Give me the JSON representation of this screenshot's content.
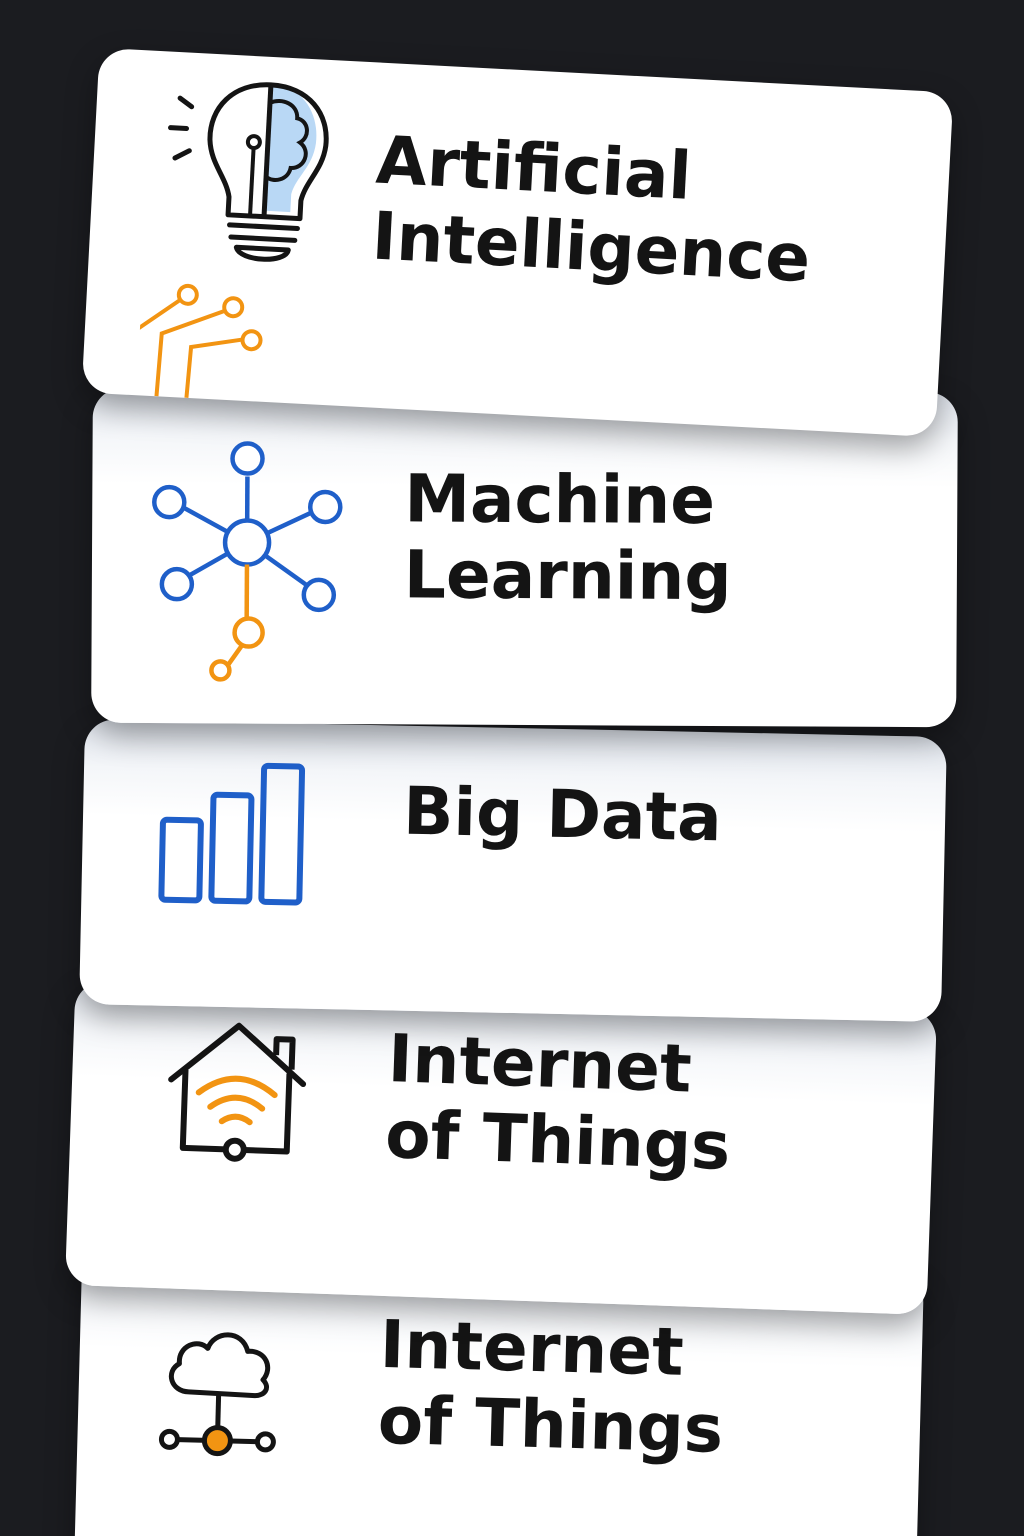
{
  "cards": [
    {
      "line1": "Artificial",
      "line2": "Intelligence",
      "icon": "ai-lightbulb-brain-icon"
    },
    {
      "line1": "Machine",
      "line2": "Learning",
      "icon": "network-nodes-icon"
    },
    {
      "line1": "Big Data",
      "line2": "",
      "icon": "bar-chart-icon"
    },
    {
      "line1": "Internet",
      "line2": "of Things",
      "icon": "smart-home-wifi-icon"
    },
    {
      "line1": "Internet",
      "line2": "of Things",
      "icon": "cloud-network-icon"
    }
  ],
  "colors": {
    "background": "#1b1c20",
    "card": "#ffffff",
    "blue": "#1f5fc9",
    "orange": "#f29412",
    "light_blue": "#b9d8f5",
    "ink": "#141414"
  }
}
